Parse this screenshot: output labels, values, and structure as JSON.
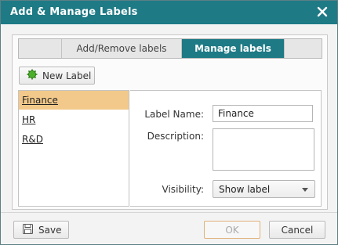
{
  "dialog": {
    "title": "Add & Manage Labels",
    "close_icon": "close-icon"
  },
  "tabs": [
    {
      "label": "Add/Remove labels",
      "selected": false
    },
    {
      "label": "Manage labels",
      "selected": true
    }
  ],
  "toolbar": {
    "new_label": "New Label",
    "new_label_icon": "label-gear-icon"
  },
  "labels": [
    {
      "name": "Finance",
      "selected": true
    },
    {
      "name": "HR",
      "selected": false
    },
    {
      "name": "R&D",
      "selected": false
    }
  ],
  "details": {
    "name_label": "Label Name:",
    "name_value": "Finance",
    "description_label": "Description:",
    "description_value": "",
    "visibility_label": "Visibility:",
    "visibility_value": "Show label"
  },
  "footer": {
    "save": "Save",
    "save_icon": "floppy-disk-icon",
    "ok": "OK",
    "cancel": "Cancel"
  },
  "colors": {
    "titlebar": "#1e7a85",
    "selected_tab": "#1e7a85",
    "selected_item": "#f2c98a",
    "new_label_icon": "#4caf2a"
  }
}
